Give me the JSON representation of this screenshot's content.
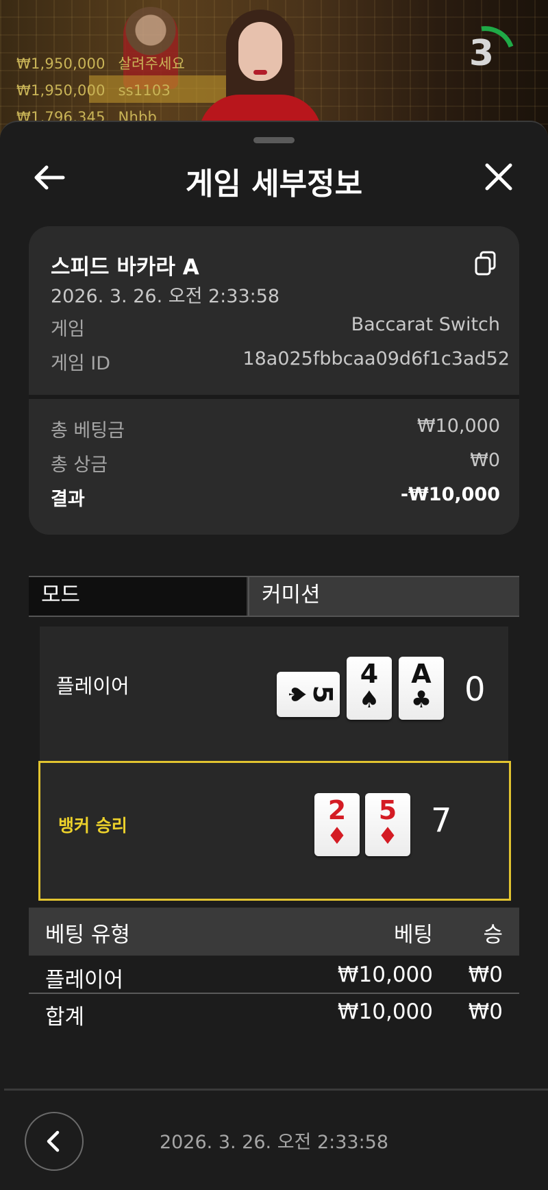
{
  "live": {
    "leaderboard": [
      {
        "amount": "₩1,950,000",
        "name": "살려주세요"
      },
      {
        "amount": "₩1,950,000",
        "name": "ss1103"
      },
      {
        "amount": "₩1,796,345",
        "name": "Nhbb"
      }
    ],
    "timer": "3",
    "timer_color": "#1faa47"
  },
  "sheet": {
    "title": "게임 세부정보",
    "back_icon": "arrow-left-icon",
    "close_icon": "close-icon"
  },
  "summary": {
    "table_name": "스피드 바카라 A",
    "datetime": "2026. 3. 26. 오전 2:33:58",
    "game_label": "게임",
    "game_value": "Baccarat Switch",
    "game_id_label": "게임 ID",
    "game_id_value": "18a025fbbcaa09d6f1c3ad52",
    "total_bet_label": "총 베팅금",
    "total_bet_value": "₩10,000",
    "total_win_label": "총 상금",
    "total_win_value": "₩0",
    "result_label": "결과",
    "result_value": "-₩10,000"
  },
  "tabs": [
    {
      "label": "모드",
      "active": true
    },
    {
      "label": "커미션",
      "active": false
    }
  ],
  "player_hand": {
    "label": "플레이어",
    "score": "0",
    "cards": [
      {
        "rank": "5",
        "suit": "♠",
        "color": "black",
        "orientation": "sideways"
      },
      {
        "rank": "4",
        "suit": "♠",
        "color": "black",
        "orientation": "upright"
      },
      {
        "rank": "A",
        "suit": "♣",
        "color": "black",
        "orientation": "upright"
      }
    ]
  },
  "banker_hand": {
    "label": "뱅커 승리",
    "score": "7",
    "highlight_color": "#e2c430",
    "cards": [
      {
        "rank": "2",
        "suit": "♦",
        "color": "red",
        "orientation": "upright"
      },
      {
        "rank": "5",
        "suit": "♦",
        "color": "red",
        "orientation": "upright"
      }
    ]
  },
  "bets": {
    "headers": {
      "type": "베팅 유형",
      "bet": "베팅",
      "win": "승"
    },
    "rows": [
      {
        "type": "플레이어",
        "bet": "₩10,000",
        "win": "₩0"
      }
    ],
    "total": {
      "type": "합계",
      "bet": "₩10,000",
      "win": "₩0"
    }
  },
  "footer": {
    "datetime": "2026. 3. 26. 오전 2:33:58",
    "prev_icon": "chevron-left-icon"
  }
}
